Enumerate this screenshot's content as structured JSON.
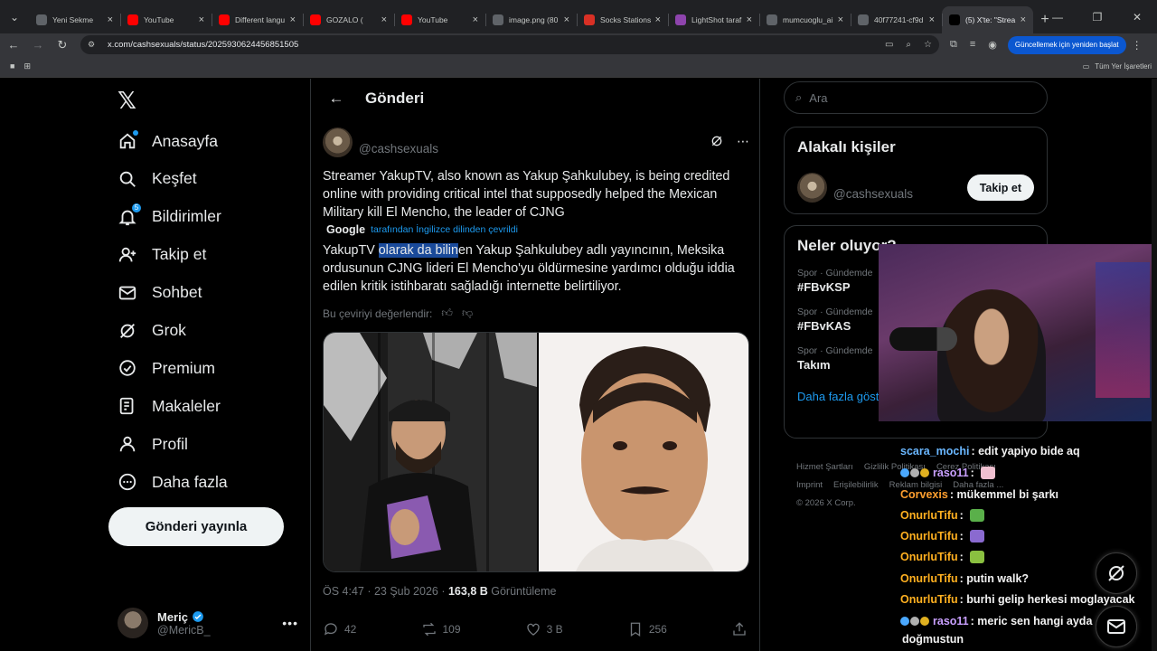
{
  "browser": {
    "tabs": [
      {
        "title": "Yeni Sekme",
        "icon": "chrome-icon",
        "color": "#5f6368"
      },
      {
        "title": "YouTube",
        "icon": "youtube-icon",
        "color": "#ff0000"
      },
      {
        "title": "Different langu",
        "icon": "youtube-icon",
        "color": "#ff0000"
      },
      {
        "title": "GOZALO (",
        "icon": "youtube-icon",
        "color": "#ff0000"
      },
      {
        "title": "YouTube",
        "icon": "youtube-icon",
        "color": "#ff0000"
      },
      {
        "title": "image.png (80",
        "icon": "globe-icon",
        "color": "#5f6368"
      },
      {
        "title": "Socks Stations",
        "icon": "socks-icon",
        "color": "#d93025"
      },
      {
        "title": "LightShot taraf",
        "icon": "feather-icon",
        "color": "#8e44ad"
      },
      {
        "title": "mumcuoglu_ai",
        "icon": "globe-icon",
        "color": "#5f6368"
      },
      {
        "title": "40f77241-cf9d",
        "icon": "globe-icon",
        "color": "#5f6368"
      },
      {
        "title": "(5) X'te: \"Strea",
        "icon": "x-icon",
        "color": "#000000"
      }
    ],
    "url": "x.com/cashsexuals/status/2025930624456851505",
    "update_label": "Güncellemek için yeniden başlat",
    "bookmarks_all": "Tüm Yer İşaretleri"
  },
  "nav": {
    "items": [
      {
        "label": "Anasayfa",
        "icon": "home-icon"
      },
      {
        "label": "Keşfet",
        "icon": "search-icon"
      },
      {
        "label": "Bildirimler",
        "icon": "bell-icon",
        "badge": "5"
      },
      {
        "label": "Takip et",
        "icon": "person-add-icon"
      },
      {
        "label": "Sohbet",
        "icon": "mail-icon"
      },
      {
        "label": "Grok",
        "icon": "grok-icon"
      },
      {
        "label": "Premium",
        "icon": "premium-icon"
      },
      {
        "label": "Makaleler",
        "icon": "article-icon"
      },
      {
        "label": "Profil",
        "icon": "person-icon"
      },
      {
        "label": "Daha fazla",
        "icon": "more-circle-icon"
      }
    ],
    "post_button": "Gönderi yayınla",
    "account": {
      "name": "Meriç",
      "handle": "@MericB_"
    }
  },
  "main": {
    "header_title": "Gönderi",
    "author_handle": "@cashsexuals",
    "text": "Streamer YakupTV, also known as Yakup Şahkulubey, is being credited online with providing critical intel that supposedly helped the Mexican Military kill El Mencho, the leader of CJNG",
    "translation_provider": "Google",
    "translation_note": "tarafından İngilizce dilinden çevrildi",
    "translated_before": "YakupTV ",
    "translated_highlight": "olarak da bilin",
    "translated_after": "en Yakup Şahkulubey adlı yayıncının, Meksika ordusunun CJNG lideri El Mencho'yu öldürmesine yardımcı olduğu iddia edilen kritik istihbaratı sağladığı internette belirtiliyor.",
    "rate_translation": "Bu çeviriyi değerlendir:",
    "time": "ÖS 4:47 · 23 Şub 2026 · ",
    "views": "163,8 B",
    "views_label": " Görüntüleme",
    "replies": "42",
    "reposts": "109",
    "likes": "3 B",
    "bookmarks": "256"
  },
  "right": {
    "search_placeholder": "Ara",
    "related_title": "Alakalı kişiler",
    "related_handle": "@cashsexuals",
    "follow_label": "Takip et",
    "trends_title": "Neler oluyor?",
    "trends": [
      {
        "category": "Spor · Gündemde",
        "name": "#FBvKSP"
      },
      {
        "category": "Spor · Gündemde",
        "name": "#FBvKAS"
      },
      {
        "category": "Spor · Gündemde",
        "name": "Takım"
      }
    ],
    "show_more": "Daha fazla göster",
    "footer": [
      "Hizmet Şartları",
      "Gizlilik Politikası",
      "Çerez Politikası",
      "Imprint",
      "Erişilebilirlik",
      "Reklam bilgisi",
      "Daha fazla ...",
      "© 2026 X Corp."
    ]
  },
  "chat": {
    "messages": [
      {
        "user": "scara_mochi",
        "color": "#6ab7ff",
        "text": ": edit yapiyo bide aq"
      },
      {
        "user": "raso11",
        "color": "#c9a0ff",
        "text": ": ",
        "badges": true,
        "emote": "#f0c0d0"
      },
      {
        "user": "Corvexis",
        "color": "#ff9f2e",
        "text": ": mükemmel bi şarkı"
      },
      {
        "user": "OnurluTifu",
        "color": "#ffb020",
        "text": ": ",
        "emote": "#5ab04a"
      },
      {
        "user": "OnurluTifu",
        "color": "#ffb020",
        "text": ": ",
        "emote": "#8a6ad0"
      },
      {
        "user": "OnurluTifu",
        "color": "#ffb020",
        "text": ": ",
        "emote": "#8ac040"
      },
      {
        "user": "OnurluTifu",
        "color": "#ffb020",
        "text": ": putin walk?"
      },
      {
        "user": "OnurluTifu",
        "color": "#ffb020",
        "text": ": burhi gelip herkesi moglayacak"
      },
      {
        "user": "raso11",
        "color": "#c9a0ff",
        "text": ": meric sen hangi ayda",
        "badges": true
      },
      {
        "user": "",
        "color": "#ffffff",
        "text": "doğmustun"
      }
    ]
  }
}
